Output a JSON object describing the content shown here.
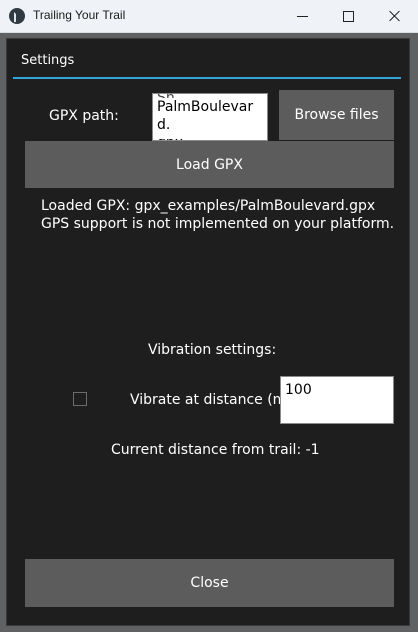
{
  "window": {
    "title": "Trailing Your Trail",
    "controls": {
      "minimize_icon": "minimize-icon",
      "maximize_icon": "maximize-icon",
      "close_icon": "close-icon"
    }
  },
  "popup": {
    "title": "Settings",
    "accent_color": "#33a3dc",
    "gpx": {
      "label": "GPX path:",
      "input_value": "PalmBoulevard.\ngpx",
      "browse_label": "Browse files",
      "load_label": "Load GPX"
    },
    "status": {
      "loaded": "Loaded GPX: gpx_examples/PalmBoulevard.gpx",
      "gps": "GPS support is not implemented on your platform."
    },
    "vibration": {
      "heading": "Vibration settings:",
      "checkbox_checked": false,
      "distance_label": "Vibrate at distance (m)",
      "distance_value": "100",
      "current_distance": "Current distance from trail: -1"
    },
    "close_label": "Close"
  }
}
